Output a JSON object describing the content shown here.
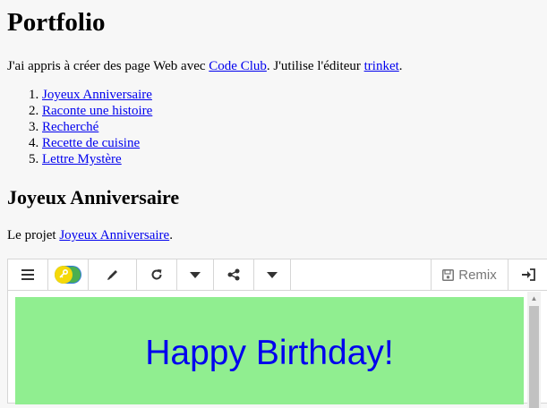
{
  "page": {
    "title": "Portfolio",
    "intro": {
      "prefix": "J'ai appris à créer des page Web avec ",
      "link1": "Code Club",
      "middle": ". J'utilise l'éditeur ",
      "link2": "trinket",
      "suffix": "."
    },
    "projects": [
      "Joyeux Anniversaire",
      "Raconte une histoire",
      "Recherché",
      "Recette de cuisine",
      "Lettre Mystère"
    ],
    "section_title": "Joyeux Anniversaire",
    "section_text": {
      "prefix": "Le projet ",
      "link": "Joyeux Anniversaire",
      "suffix": "."
    }
  },
  "trinket": {
    "toolbar": {
      "menu_icon": "hamburger-menu-icon",
      "key_icon": "key-toggle-icon",
      "edit_icon": "pencil-icon",
      "refresh_icon": "refresh-icon",
      "share_icon": "share-icon",
      "remix_label": "Remix",
      "login_icon": "sign-in-icon"
    },
    "output": {
      "heading": "Happy Birthday!",
      "background": "#90ee90",
      "text_color": "#0000ee"
    }
  }
}
